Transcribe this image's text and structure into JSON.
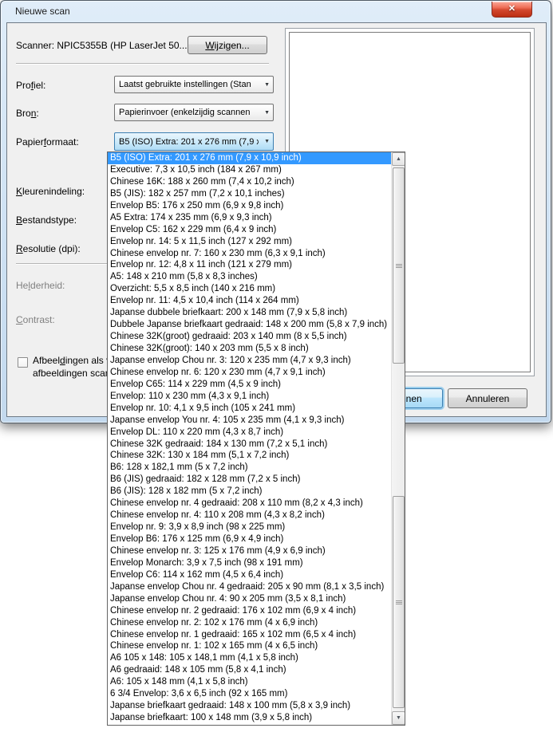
{
  "window": {
    "title": "Nieuwe scan"
  },
  "icons": {
    "close": "✕",
    "chevron_down": "▼",
    "scroll_up": "▲",
    "scroll_down": "▼"
  },
  "colors": {
    "selection_blue": "#3399ff",
    "titlebar_glass": "#d8e8f6",
    "close_button_red": "#d3482e",
    "default_button_border": "#3c7fb1",
    "dialog_bg": "#f0f0f0"
  },
  "scanner": {
    "label": "Scanner: NPIC5355B (HP LaserJet 50...",
    "change_button": {
      "pre": "",
      "accel": "W",
      "post": "ijzigen..."
    }
  },
  "profiel": {
    "label": {
      "pre": "Pro",
      "accel": "f",
      "post": "iel:"
    },
    "value": "Laatst gebruikte instellingen (Stan"
  },
  "bron": {
    "label": {
      "pre": "Bro",
      "accel": "n",
      "post": ":"
    },
    "value": "Papierinvoer (enkelzijdig scannen"
  },
  "papierformaat": {
    "label": {
      "pre": "Papier",
      "accel": "f",
      "post": "ormaat:"
    },
    "value": "B5 (ISO) Extra: 201 x 276 mm (7,9 x"
  },
  "kleurenindeling": {
    "label": {
      "pre": "",
      "accel": "K",
      "post": "leurenindeling:"
    }
  },
  "bestandstype": {
    "label": {
      "pre": "",
      "accel": "B",
      "post": "estandstype:"
    }
  },
  "resolutie": {
    "label": {
      "pre": "",
      "accel": "R",
      "post": "esolutie (dpi):"
    }
  },
  "helderheid": {
    "label": {
      "pre": "He",
      "accel": "l",
      "post": "derheid:"
    }
  },
  "contrast": {
    "label": {
      "pre": "",
      "accel": "C",
      "post": "ontrast:"
    }
  },
  "checkbox": {
    "checked": false,
    "line1": {
      "pre": "Afbeel",
      "accel": "d",
      "post": "ingen als v"
    },
    "line2": "afbeeldingen scan"
  },
  "buttons": {
    "scan": "Scannen",
    "cancel": "Annuleren"
  },
  "dropdown": {
    "selected_index": 0,
    "items": [
      "B5 (ISO) Extra: 201 x 276 mm (7,9 x 10,9 inch)",
      "Executive: 7,3 x 10,5 inch (184 x 267 mm)",
      "Chinese 16K: 188 x 260 mm (7,4 x 10,2 inch)",
      "B5 (JIS): 182 x 257 mm (7,2 x 10,1 inches)",
      "Envelop B5: 176 x 250 mm (6,9 x 9,8 inch)",
      "A5 Extra: 174 x 235 mm (6,9 x 9,3 inch)",
      "Envelop C5: 162 x 229 mm (6,4 x 9 inch)",
      "Envelop nr. 14: 5 x 11,5 inch (127 x 292 mm)",
      "Chinese envelop nr. 7: 160 x 230 mm (6,3 x 9,1 inch)",
      "Envelop nr. 12: 4,8 x 11 inch (121 x 279 mm)",
      "A5: 148 x 210 mm (5,8 x 8,3 inches)",
      "Overzicht: 5,5 x 8,5 inch (140 x 216 mm)",
      "Envelop nr. 11: 4,5 x 10,4 inch (114 x 264 mm)",
      "Japanse dubbele briefkaart: 200 x 148 mm (7,9 x 5,8 inch)",
      "Dubbele Japanse briefkaart gedraaid: 148 x 200 mm (5,8 x 7,9 inch)",
      "Chinese 32K(groot) gedraaid: 203 x 140 mm (8 x 5,5 inch)",
      "Chinese 32K(groot): 140 x 203 mm (5,5 x 8 inch)",
      "Japanse envelop Chou nr. 3: 120 x 235 mm (4,7 x 9,3 inch)",
      "Chinese envelop nr. 6: 120 x 230 mm (4,7 x 9,1 inch)",
      "Envelop C65: 114 x 229 mm (4,5 x 9 inch)",
      "Envelop: 110 x 230 mm (4,3 x 9,1 inch)",
      "Envelop nr. 10: 4,1 x 9,5 inch (105 x 241 mm)",
      "Japanse envelop You nr. 4: 105 x 235 mm (4,1 x 9,3 inch)",
      "Envelop DL: 110 x 220 mm (4,3 x 8,7 inch)",
      "Chinese 32K gedraaid: 184 x 130 mm (7,2 x 5,1 inch)",
      "Chinese 32K: 130 x 184 mm (5,1 x 7,2 inch)",
      "B6: 128 x 182,1 mm (5 x 7,2 inch)",
      "B6 (JIS) gedraaid: 182 x 128 mm (7,2 x 5 inch)",
      "B6 (JIS): 128 x 182 mm (5 x 7,2 inch)",
      "Chinese envelop nr. 4 gedraaid: 208 x 110 mm (8,2 x 4,3 inch)",
      "Chinese envelop nr. 4: 110 x 208 mm (4,3 x 8,2 inch)",
      "Envelop nr. 9: 3,9 x 8,9 inch (98 x 225 mm)",
      "Envelop B6: 176 x 125 mm (6,9 x 4,9 inch)",
      "Chinese envelop nr. 3: 125 x 176 mm (4,9 x 6,9 inch)",
      "Envelop Monarch: 3,9 x 7,5 inch (98 x 191 mm)",
      "Envelop C6: 114 x 162 mm (4,5 x 6,4 inch)",
      "Japanse envelop Chou nr. 4 gedraaid: 205 x 90 mm (8,1 x 3,5 inch)",
      "Japanse envelop Chou nr. 4: 90 x 205 mm (3,5 x 8,1 inch)",
      "Chinese envelop nr. 2 gedraaid: 176 x 102 mm (6,9 x 4 inch)",
      "Chinese envelop nr. 2: 102 x 176 mm (4 x 6,9 inch)",
      "Chinese envelop nr. 1 gedraaid: 165 x 102 mm (6,5 x 4 inch)",
      "Chinese envelop nr. 1: 102 x 165 mm (4 x 6,5 inch)",
      "A6 105 x 148:  105 x 148,1 mm (4,1 x 5,8 inch)",
      "A6 gedraaid: 148 x 105 mm (5,8 x 4,1 inch)",
      "A6: 105 x 148 mm (4,1 x 5,8 inch)",
      "6 3/4 Envelop: 3,6 x 6,5 inch (92 x 165 mm)",
      "Japanse briefkaart gedraaid: 148 x 100 mm (5,8 x 3,9 inch)",
      "Japanse briefkaart: 100 x 148 mm (3,9 x 5,8 inch)"
    ]
  }
}
